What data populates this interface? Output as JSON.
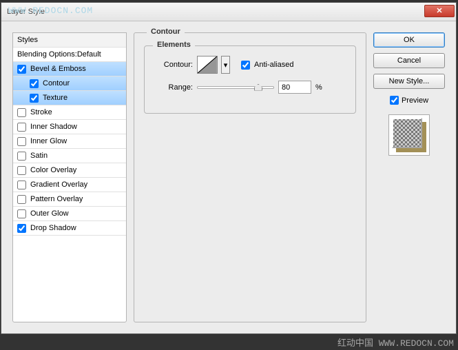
{
  "window": {
    "title": "Layer Style"
  },
  "watermark": {
    "top": "WWW.REDOCN.COM",
    "bottom": "红动中国 WWW.REDOCN.COM"
  },
  "styles": {
    "header": "Styles",
    "blending": "Blending Options:Default",
    "items": [
      {
        "label": "Bevel & Emboss",
        "checked": true,
        "selected": true,
        "indent": false
      },
      {
        "label": "Contour",
        "checked": true,
        "selected": true,
        "indent": true
      },
      {
        "label": "Texture",
        "checked": true,
        "selected": true,
        "indent": true
      },
      {
        "label": "Stroke",
        "checked": false,
        "selected": false,
        "indent": false
      },
      {
        "label": "Inner Shadow",
        "checked": false,
        "selected": false,
        "indent": false
      },
      {
        "label": "Inner Glow",
        "checked": false,
        "selected": false,
        "indent": false
      },
      {
        "label": "Satin",
        "checked": false,
        "selected": false,
        "indent": false
      },
      {
        "label": "Color Overlay",
        "checked": false,
        "selected": false,
        "indent": false
      },
      {
        "label": "Gradient Overlay",
        "checked": false,
        "selected": false,
        "indent": false
      },
      {
        "label": "Pattern Overlay",
        "checked": false,
        "selected": false,
        "indent": false
      },
      {
        "label": "Outer Glow",
        "checked": false,
        "selected": false,
        "indent": false
      },
      {
        "label": "Drop Shadow",
        "checked": true,
        "selected": false,
        "indent": false
      }
    ]
  },
  "panel": {
    "title": "Contour",
    "group": "Elements",
    "contour_label": "Contour:",
    "anti_aliased_label": "Anti-aliased",
    "anti_aliased_checked": true,
    "range_label": "Range:",
    "range_value": "80",
    "range_unit": "%",
    "range_percent": 80
  },
  "buttons": {
    "ok": "OK",
    "cancel": "Cancel",
    "new_style": "New Style...",
    "preview_label": "Preview",
    "preview_checked": true
  }
}
